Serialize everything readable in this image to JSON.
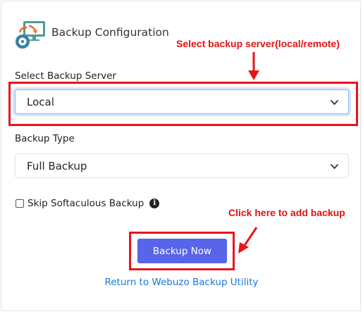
{
  "header": {
    "title": "Backup Configuration",
    "icon": "backup-monitor-icon"
  },
  "annotations": {
    "select_server_hint": "Select backup server(local/remote)",
    "add_backup_hint": "Click here to add backup",
    "color": "#e21212"
  },
  "form": {
    "server_label": "Select Backup Server",
    "server_value": "Local",
    "type_label": "Backup Type",
    "type_value": "Full Backup",
    "skip_label": "Skip Softaculous Backup",
    "skip_checked": false,
    "info_icon_glyph": "i"
  },
  "actions": {
    "backup_now_label": "Backup Now",
    "return_link_label": "Return to Webuzo Backup Utility"
  },
  "colors": {
    "button": "#5865e8",
    "link": "#1a78d6",
    "highlight": "#e8141b"
  }
}
